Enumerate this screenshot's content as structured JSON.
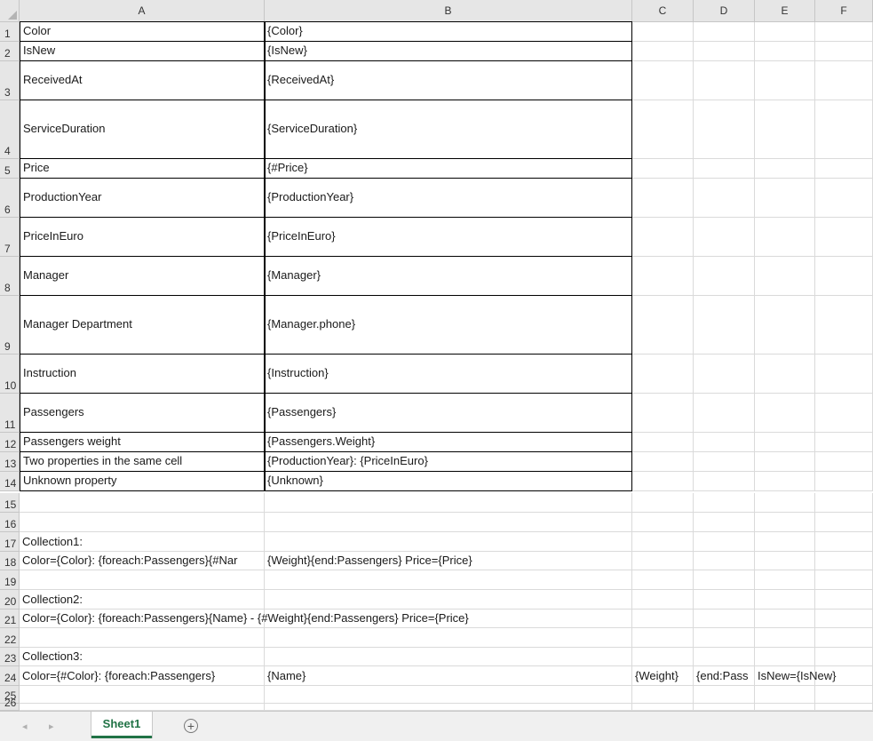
{
  "columns": [
    "A",
    "B",
    "C",
    "D",
    "E",
    "F"
  ],
  "rows": [
    "1",
    "2",
    "3",
    "4",
    "5",
    "6",
    "7",
    "8",
    "9",
    "10",
    "11",
    "12",
    "13",
    "14",
    "15",
    "16",
    "17",
    "18",
    "19",
    "20",
    "21",
    "22",
    "23",
    "24",
    "25",
    "26"
  ],
  "table": [
    {
      "label": "Color",
      "value": "{Color}"
    },
    {
      "label": "IsNew",
      "value": "{IsNew}"
    },
    {
      "label": "ReceivedAt",
      "value": "{ReceivedAt}"
    },
    {
      "label": "ServiceDuration",
      "value": "{ServiceDuration}"
    },
    {
      "label": "Price",
      "value": "{#Price}"
    },
    {
      "label": "ProductionYear",
      "value": "{ProductionYear}"
    },
    {
      "label": "PriceInEuro",
      "value": "{PriceInEuro}"
    },
    {
      "label": "Manager",
      "value": "{Manager}"
    },
    {
      "label": "Manager Department",
      "value": "{Manager.phone}"
    },
    {
      "label": "Instruction",
      "value": "{Instruction}"
    },
    {
      "label": "Passengers",
      "value": "{Passengers}"
    },
    {
      "label": "Passengers weight",
      "value": "{Passengers.Weight}"
    },
    {
      "label": "Two properties in the same cell",
      "value": "{ProductionYear}: {PriceInEuro}"
    },
    {
      "label": "Unknown property",
      "value": "{Unknown}"
    }
  ],
  "extra": {
    "r17a": "Collection1:",
    "r18a": "Color={Color}: {foreach:Passengers}{#Nar",
    "r18b": "{Weight}{end:Passengers} Price={Price}",
    "r20a": "Collection2:",
    "r21a": "Color={Color}: {foreach:Passengers}{Name} - {#Weight}{end:Passengers} Price={Price}",
    "r23a": "Collection3:",
    "r24a": "Color={#Color}: {foreach:Passengers}",
    "r24b": "{Name}",
    "r24c": "{Weight}",
    "r24d": "{end:Pass",
    "r24e": "IsNew={IsNew}"
  },
  "tabs": {
    "prev": "◂",
    "next": "▸",
    "sheet1": "Sheet1",
    "add": "+"
  },
  "colors": {
    "accent": "#217346",
    "header_bg": "#e6e6e6",
    "grid": "#dadada"
  }
}
